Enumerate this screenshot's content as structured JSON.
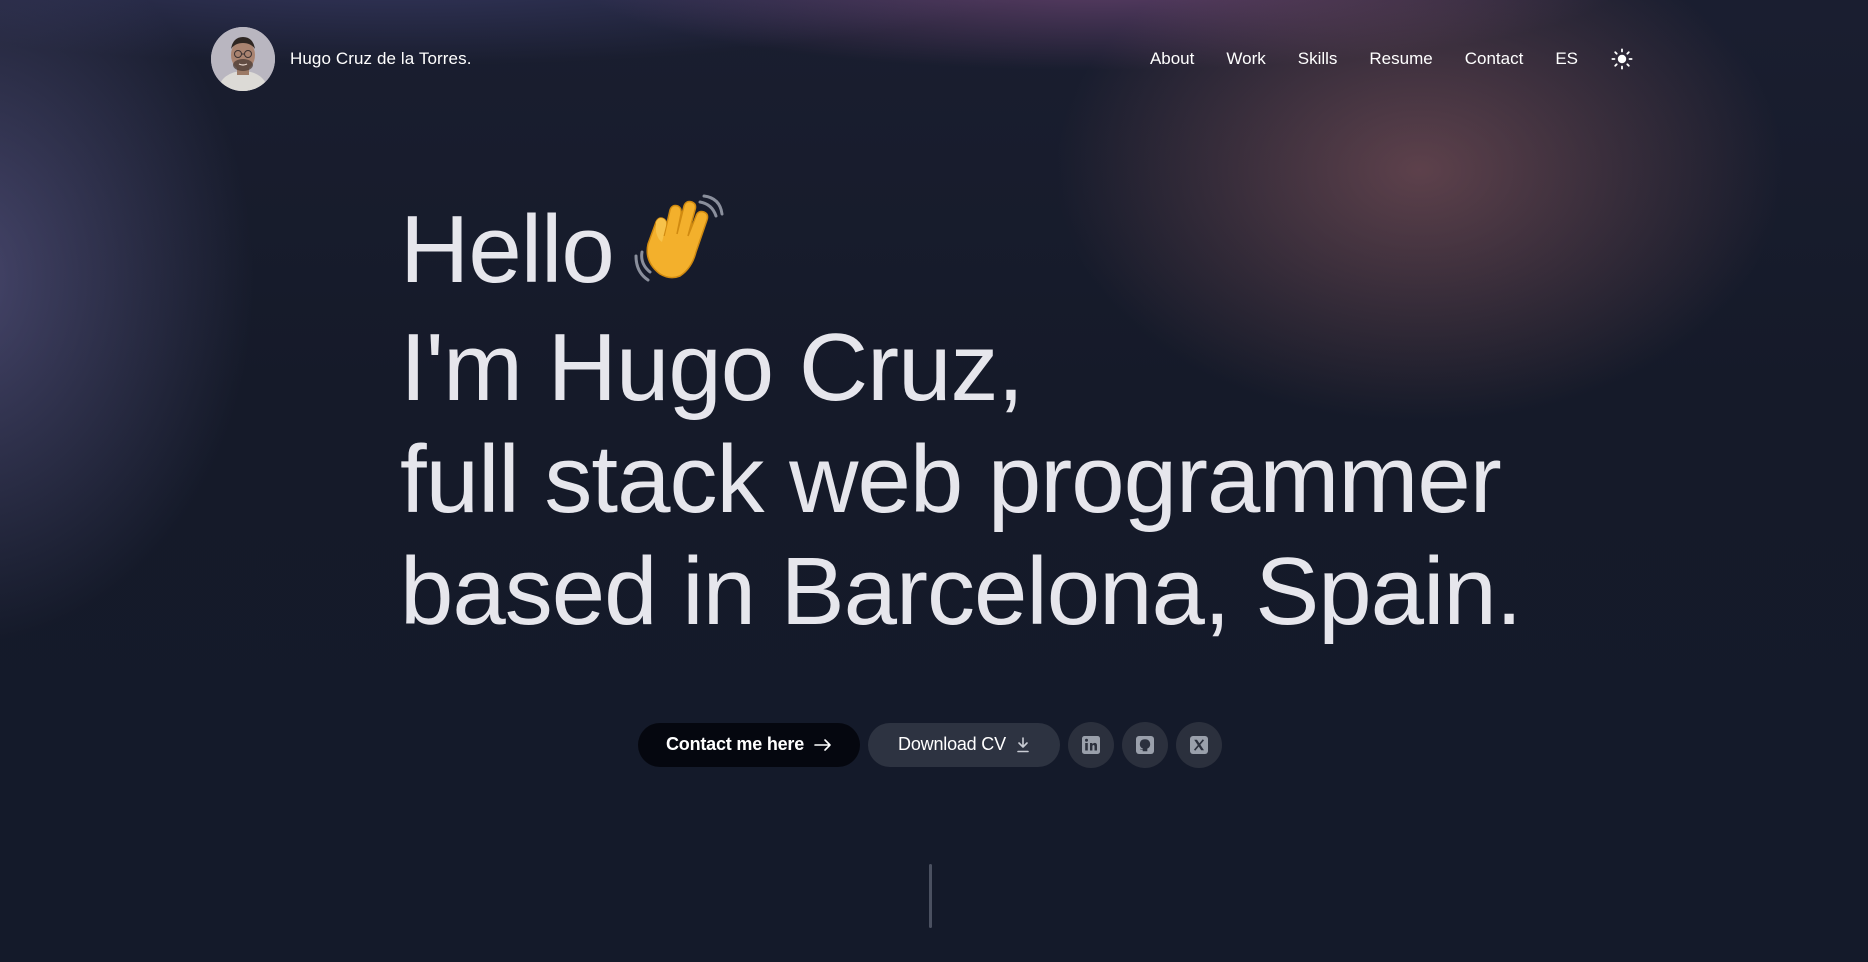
{
  "header": {
    "brand_name": "Hugo Cruz de la Torres.",
    "nav": [
      {
        "label": "About"
      },
      {
        "label": "Work"
      },
      {
        "label": "Skills"
      },
      {
        "label": "Resume"
      },
      {
        "label": "Contact"
      },
      {
        "label": "ES"
      }
    ],
    "theme_icon": "sun-icon"
  },
  "hero": {
    "line1": "Hello",
    "line1_emoji": "waving-hand-icon",
    "line2": "I'm Hugo Cruz,",
    "line3": "full stack web programmer",
    "line4": "based in Barcelona, Spain."
  },
  "actions": {
    "contact_label": "Contact me here",
    "contact_icon": "arrow-right-icon",
    "download_label": "Download CV",
    "download_icon": "download-icon",
    "socials": [
      {
        "icon": "linkedin-icon"
      },
      {
        "icon": "github-icon"
      },
      {
        "icon": "x-icon"
      }
    ]
  },
  "colors": {
    "background": "#141a2a",
    "text": "#e6e6ec",
    "primary_button": "#05070f",
    "secondary_button": "#2d3341",
    "icon_button": "#2b303d"
  }
}
